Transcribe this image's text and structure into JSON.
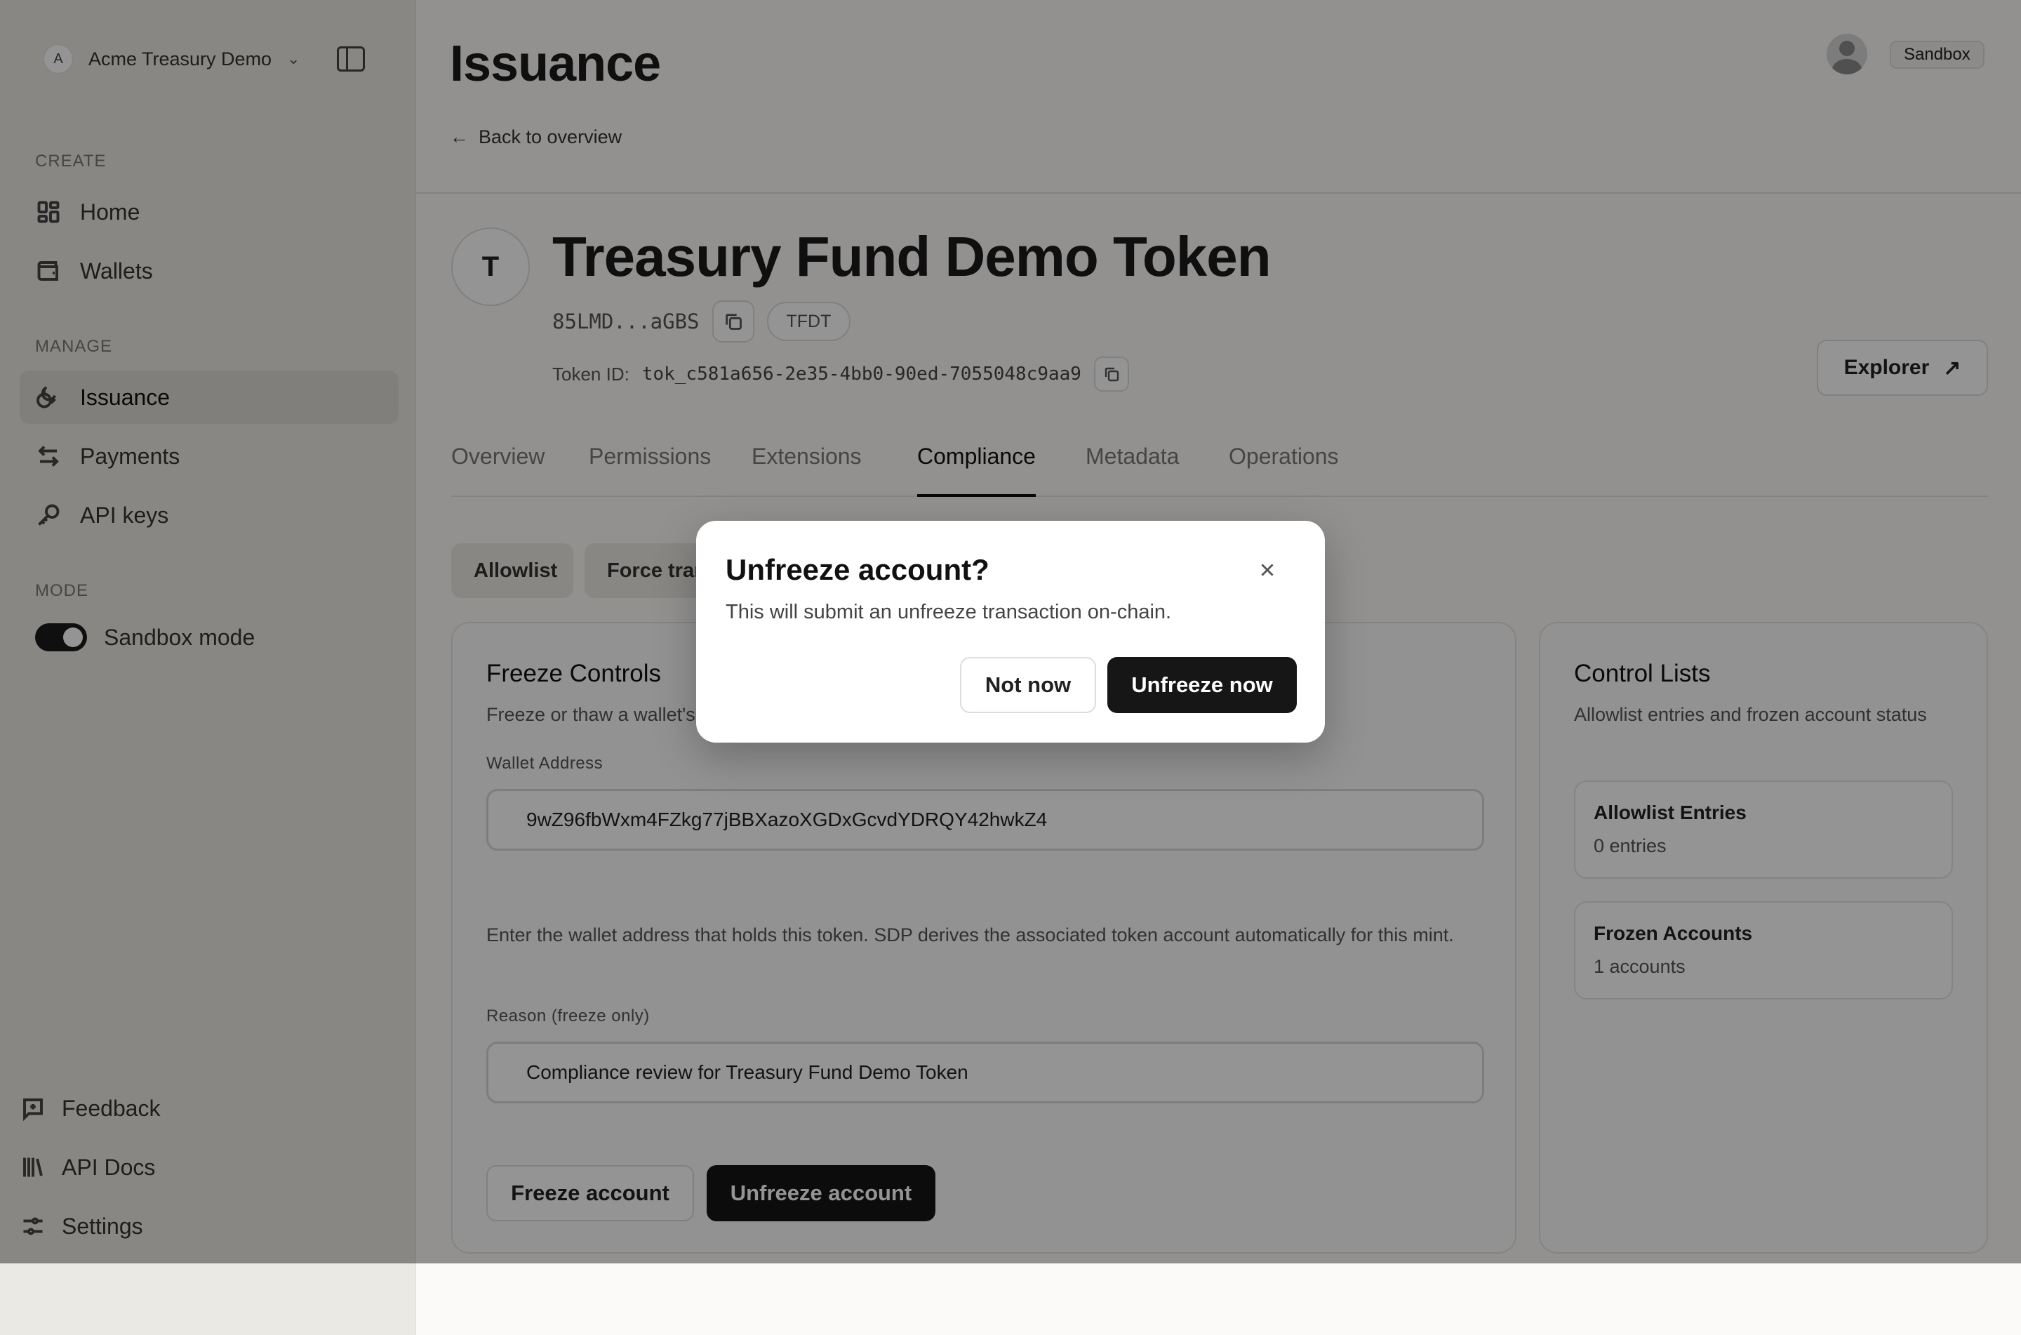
{
  "sidebar": {
    "workspace": {
      "logo": "A",
      "name": "Acme Treasury Demo",
      "icon": "chevron-down-icon"
    },
    "sections": {
      "create": "CREATE",
      "manage": "MANAGE",
      "mode": "MODE"
    },
    "nav": [
      {
        "label": "Home",
        "icon": "grid-icon"
      },
      {
        "label": "Wallets",
        "icon": "wallet-icon"
      },
      {
        "label": "Issuance",
        "icon": "coins-icon",
        "active": true
      },
      {
        "label": "Payments",
        "icon": "arrows-icon"
      },
      {
        "label": "API keys",
        "icon": "key-icon"
      }
    ],
    "mode_toggle": {
      "label": "Sandbox mode",
      "on": true
    },
    "bottom": [
      {
        "label": "Feedback",
        "icon": "message-plus-icon"
      },
      {
        "label": "API Docs",
        "icon": "library-icon"
      },
      {
        "label": "Settings",
        "icon": "sliders-icon"
      }
    ]
  },
  "header": {
    "title": "Issuance",
    "back_label": "Back to overview",
    "env_badge": "Sandbox"
  },
  "token": {
    "initial": "T",
    "name": "Treasury Fund Demo Token",
    "address_short": "85LMD...aGBS",
    "symbol": "TFDT",
    "id_label": "Token ID:",
    "id_value": "tok_c581a656-2e35-4bb0-90ed-7055048c9aa9",
    "explorer_label": "Explorer"
  },
  "tabs": [
    {
      "label": "Overview"
    },
    {
      "label": "Permissions"
    },
    {
      "label": "Extensions"
    },
    {
      "label": "Compliance",
      "active": true
    },
    {
      "label": "Metadata"
    },
    {
      "label": "Operations"
    }
  ],
  "subtabs": [
    {
      "label": "Allowlist"
    },
    {
      "label": "Force transfer"
    }
  ],
  "freeze": {
    "title": "Freeze Controls",
    "description": "Freeze or thaw a wallet's",
    "wallet_label": "Wallet Address",
    "wallet_value": "9wZ96fbWxm4FZkg77jBBXazoXGDxGcvdYDRQY42hwkZ4",
    "helper": "Enter the wallet address that holds this token. SDP derives the associated token account automatically for this mint.",
    "reason_label": "Reason (freeze only)",
    "reason_value": "Compliance review for Treasury Fund Demo Token",
    "freeze_button": "Freeze account",
    "unfreeze_button": "Unfreeze account"
  },
  "control_lists": {
    "title": "Control Lists",
    "description": "Allowlist entries and frozen account status",
    "allowlist": {
      "title": "Allowlist Entries",
      "value": "0 entries"
    },
    "frozen": {
      "title": "Frozen Accounts",
      "value": "1 accounts"
    }
  },
  "modal": {
    "title": "Unfreeze account?",
    "description": "This will submit an unfreeze transaction on-chain.",
    "cancel": "Not now",
    "confirm": "Unfreeze now"
  }
}
